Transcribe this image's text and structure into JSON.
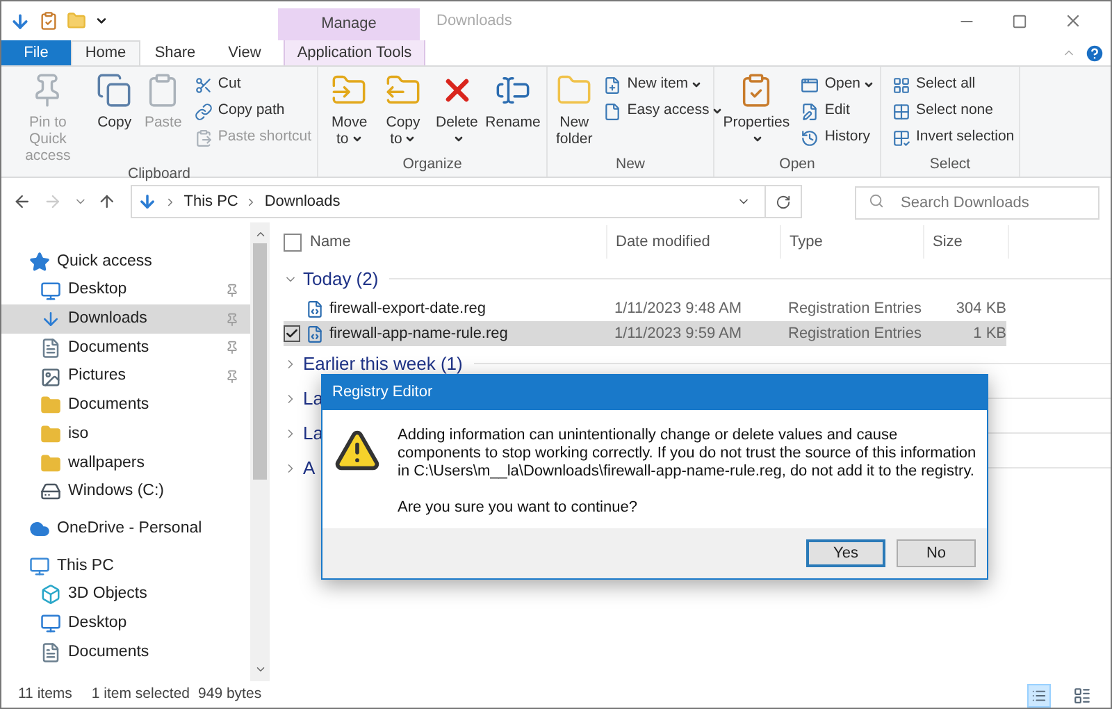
{
  "window": {
    "title": "Downloads",
    "context_tab": "Manage"
  },
  "ribbon_tabs": [
    {
      "label": "File",
      "kind": "file",
      "selected": false
    },
    {
      "label": "Home",
      "kind": "normal",
      "selected": true
    },
    {
      "label": "Share",
      "kind": "normal",
      "selected": false
    },
    {
      "label": "View",
      "kind": "normal",
      "selected": false
    },
    {
      "label": "Application Tools",
      "kind": "context",
      "selected": false
    }
  ],
  "ribbon_groups": [
    {
      "name": "Clipboard",
      "large": [
        {
          "label": "Pin to Quick access",
          "disabled": true,
          "menu": false
        },
        {
          "label": "Copy",
          "disabled": false,
          "menu": false
        },
        {
          "label": "Paste",
          "disabled": true,
          "menu": false
        }
      ],
      "small": [
        {
          "label": "Cut",
          "disabled": false,
          "menu": false
        },
        {
          "label": "Copy path",
          "disabled": false,
          "menu": false
        },
        {
          "label": "Paste shortcut",
          "disabled": true,
          "menu": false
        }
      ]
    },
    {
      "name": "Organize",
      "large": [
        {
          "label": "Move to",
          "disabled": false,
          "menu": true
        },
        {
          "label": "Copy to",
          "disabled": false,
          "menu": true
        },
        {
          "label": "Delete",
          "disabled": false,
          "menu": true
        },
        {
          "label": "Rename",
          "disabled": false,
          "menu": false
        }
      ]
    },
    {
      "name": "New",
      "large": [
        {
          "label": "New folder",
          "disabled": false,
          "menu": false
        }
      ],
      "small": [
        {
          "label": "New item",
          "disabled": false,
          "menu": true
        },
        {
          "label": "Easy access",
          "disabled": false,
          "menu": true
        }
      ]
    },
    {
      "name": "Open",
      "large": [
        {
          "label": "Properties",
          "disabled": false,
          "menu": true
        }
      ],
      "small": [
        {
          "label": "Open",
          "disabled": false,
          "menu": true
        },
        {
          "label": "Edit",
          "disabled": false,
          "menu": false
        },
        {
          "label": "History",
          "disabled": false,
          "menu": false
        }
      ]
    },
    {
      "name": "Select",
      "small": [
        {
          "label": "Select all",
          "disabled": false,
          "menu": false
        },
        {
          "label": "Select none",
          "disabled": false,
          "menu": false
        },
        {
          "label": "Invert selection",
          "disabled": false,
          "menu": false
        }
      ]
    }
  ],
  "address": {
    "path": [
      "This PC",
      "Downloads"
    ]
  },
  "search": {
    "placeholder": "Search Downloads"
  },
  "nav": [
    {
      "label": "Quick access",
      "kind": "star",
      "selected": false,
      "pinned": false,
      "children": [
        {
          "label": "Desktop",
          "kind": "desktop",
          "selected": false,
          "pinned": true
        },
        {
          "label": "Downloads",
          "kind": "download",
          "selected": true,
          "pinned": true
        },
        {
          "label": "Documents",
          "kind": "document",
          "selected": false,
          "pinned": true
        },
        {
          "label": "Pictures",
          "kind": "picture",
          "selected": false,
          "pinned": true
        },
        {
          "label": "Documents",
          "kind": "folder",
          "selected": false,
          "pinned": false
        },
        {
          "label": "iso",
          "kind": "folder",
          "selected": false,
          "pinned": false
        },
        {
          "label": "wallpapers",
          "kind": "folder",
          "selected": false,
          "pinned": false
        },
        {
          "label": "Windows (C:)",
          "kind": "drive",
          "selected": false,
          "pinned": false
        }
      ]
    },
    {
      "label": "OneDrive - Personal",
      "kind": "cloud",
      "selected": false,
      "pinned": false
    },
    {
      "label": "This PC",
      "kind": "pc",
      "selected": false,
      "pinned": false,
      "children": [
        {
          "label": "3D Objects",
          "kind": "cube",
          "selected": false,
          "pinned": false
        },
        {
          "label": "Desktop",
          "kind": "desktop",
          "selected": false,
          "pinned": false
        },
        {
          "label": "Documents",
          "kind": "document",
          "selected": false,
          "pinned": false
        }
      ]
    }
  ],
  "table": {
    "select_all_checked": false,
    "columns": [
      "Name",
      "Date modified",
      "Type",
      "Size"
    ],
    "groups": [
      {
        "label": "Today (2)",
        "expanded": true,
        "rows": [
          {
            "name": "firewall-export-date.reg",
            "date": "1/11/2023 9:48 AM",
            "type": "Registration Entries",
            "size": "304 KB",
            "selected": false
          },
          {
            "name": "firewall-app-name-rule.reg",
            "date": "1/11/2023 9:59 AM",
            "type": "Registration Entries",
            "size": "1 KB",
            "selected": true
          }
        ]
      },
      {
        "label": "Earlier this week (1)",
        "expanded": false
      },
      {
        "label": "La",
        "expanded": false
      },
      {
        "label": "La",
        "expanded": false
      },
      {
        "label": "A",
        "expanded": false
      }
    ]
  },
  "dialog": {
    "title": "Registry Editor",
    "message": "Adding information can unintentionally change or delete values and cause components to stop working correctly. If you do not trust the source of this information in C:\\Users\\m__la\\Downloads\\firewall-app-name-rule.reg, do not add it to the registry.",
    "question": "Are you sure you want to continue?",
    "buttons": [
      {
        "label": "Yes",
        "selected": true
      },
      {
        "label": "No",
        "selected": false
      }
    ]
  },
  "status_bar": {
    "items": "11 items",
    "selection": "1 item selected",
    "size": "949 bytes",
    "views": [
      {
        "kind": "details",
        "selected": true
      },
      {
        "kind": "tiles",
        "selected": false
      }
    ]
  }
}
